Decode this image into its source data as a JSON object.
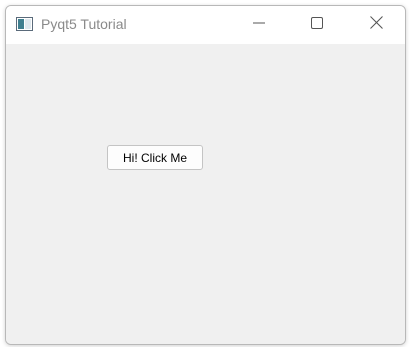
{
  "window": {
    "title": "Pyqt5 Tutorial",
    "icon": "qt-window-icon",
    "controls": {
      "minimize_icon": "minimize-icon",
      "maximize_icon": "maximize-icon",
      "close_icon": "close-icon"
    }
  },
  "main": {
    "button_label": "Hi! Click Me"
  },
  "colors": {
    "titlebar": "#ffffff",
    "client_background": "#f0f0f0",
    "title_text": "#8a8a8a",
    "button_background": "#fdfdfd",
    "button_border": "#c4c4c4"
  }
}
